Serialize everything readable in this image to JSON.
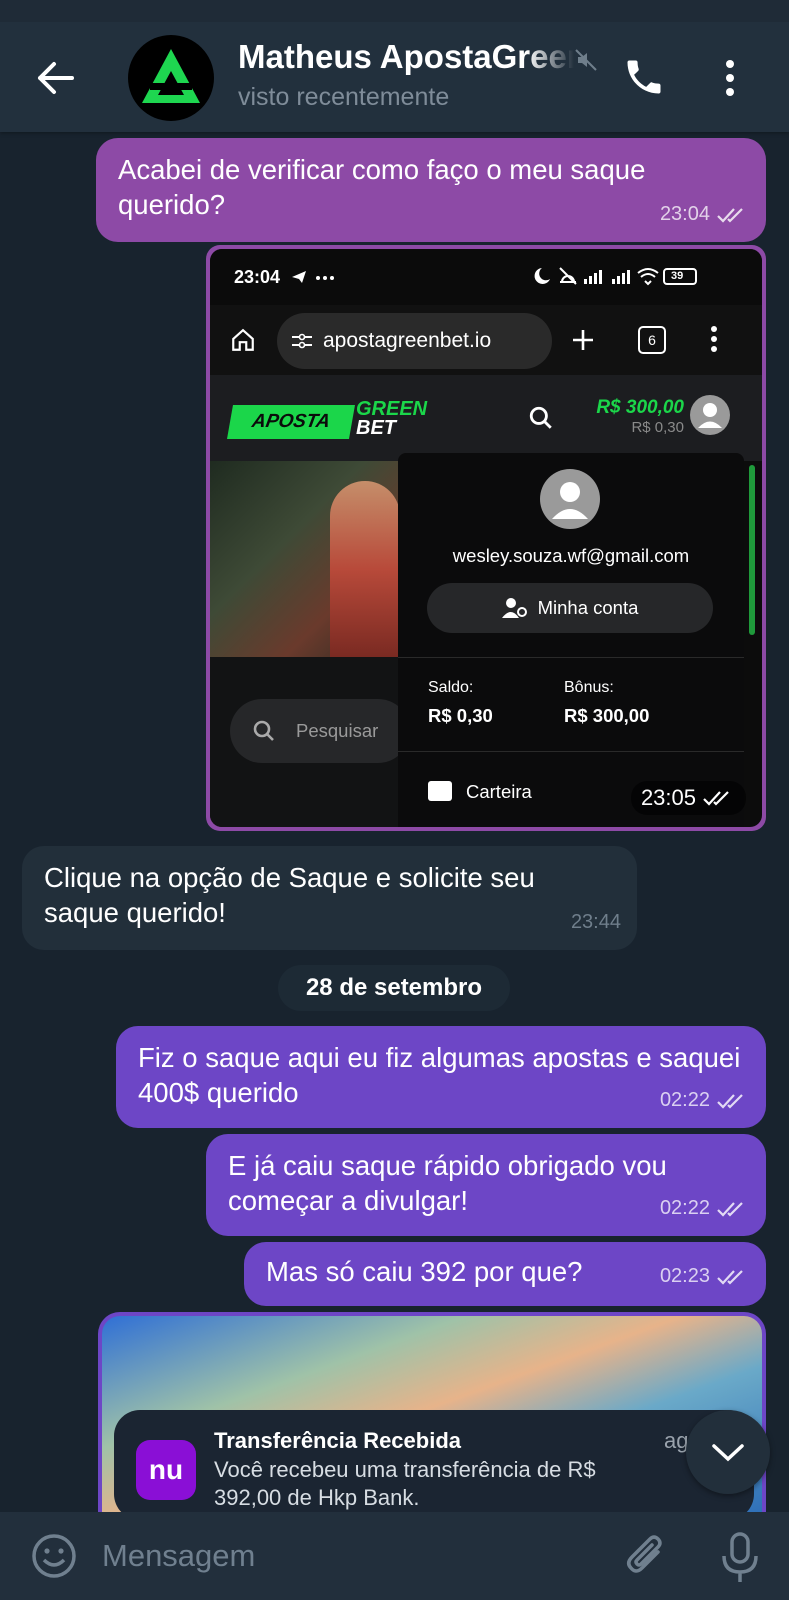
{
  "header": {
    "title": "Matheus ApostaGreenBet",
    "status": "visto recentemente"
  },
  "messages": [
    {
      "text": "Acabei de verificar como faço o meu saque querido?",
      "time": "23:04"
    },
    {
      "image_time": "23:05"
    },
    {
      "text": "Clique na opção de Saque e solicite seu saque querido!",
      "time": "23:44"
    },
    {
      "text": "Fiz o saque aqui eu fiz algumas apostas e saquei 400$ querido",
      "time": "02:22"
    },
    {
      "text": "E já caiu saque rápido obrigado vou começar a divulgar!",
      "time": "02:22"
    },
    {
      "text": "Mas só caiu 392 por que?",
      "time": "02:23"
    }
  ],
  "date_separator": "28 de setembro",
  "screenshot": {
    "time": "23:04",
    "battery": "39",
    "url": "apostagreenbet.io",
    "tabs": "6",
    "logo_aposta": "APOSTA",
    "logo_green": "GREEN",
    "logo_bet": "BET",
    "balance_main": "R$ 300,00",
    "balance_sub": "R$ 0,30",
    "email": "wesley.souza.wf@gmail.com",
    "account_button": "Minha conta",
    "saldo_label": "Saldo:",
    "saldo_value": "R$ 0,30",
    "bonus_label": "Bônus:",
    "bonus_value": "R$ 300,00",
    "wallet_label": "Carteira",
    "search_placeholder": "Pesquisar"
  },
  "notification": {
    "app_letter": "nu",
    "title": "Transferência Recebida",
    "ago": "ag",
    "body": "Você recebeu uma transferência de R$ 392,00 de Hkp Bank."
  },
  "composer": {
    "placeholder": "Mensagem"
  },
  "colors": {
    "outgoing": "#8d4aa6",
    "outgoing_alt": "#6d46c6",
    "incoming": "#222f3a",
    "brand_green": "#1bd64a"
  }
}
